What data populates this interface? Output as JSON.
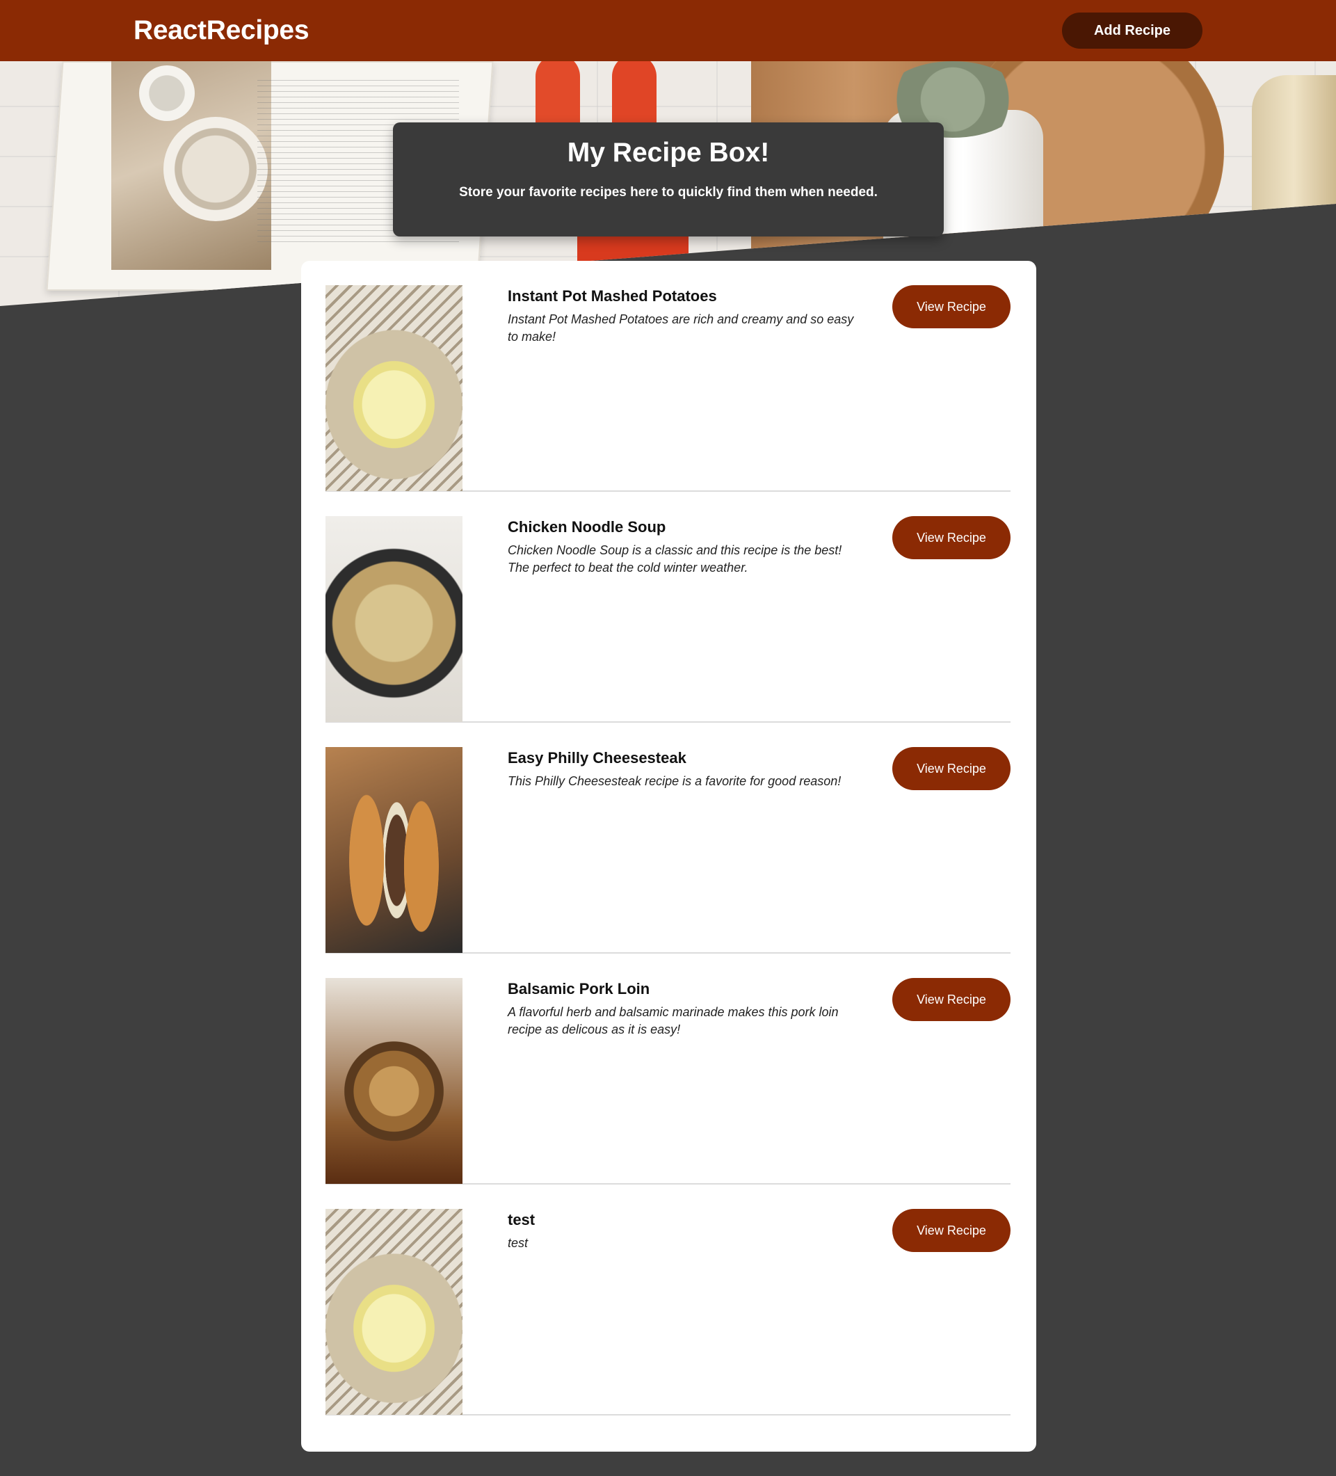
{
  "header": {
    "brand": "ReactRecipes",
    "add_button": "Add Recipe"
  },
  "hero": {
    "title": "My Recipe Box!",
    "subtitle": "Store your favorite recipes here to quickly find them when needed."
  },
  "recipes": [
    {
      "title": "Instant Pot Mashed Potatoes",
      "description": "Instant Pot Mashed Potatoes are rich and creamy and so easy to make!",
      "button": "View Recipe",
      "image_icon": "mashed-potatoes-photo"
    },
    {
      "title": "Chicken Noodle Soup",
      "description": "Chicken Noodle Soup is a classic and this recipe is the best! The perfect to beat the cold winter weather.",
      "button": "View Recipe",
      "image_icon": "chicken-noodle-soup-photo"
    },
    {
      "title": "Easy Philly Cheesesteak",
      "description": "This Philly Cheesesteak recipe is a favorite for good reason!",
      "button": "View Recipe",
      "image_icon": "philly-cheesesteak-photo"
    },
    {
      "title": "Balsamic Pork Loin",
      "description": "A flavorful herb and balsamic marinade makes this pork loin recipe as delicous as it is easy!",
      "button": "View Recipe",
      "image_icon": "pork-loin-photo"
    },
    {
      "title": "test",
      "description": "test",
      "button": "View Recipe",
      "image_icon": "mashed-potatoes-photo"
    }
  ],
  "colors": {
    "brand": "#8b2a04",
    "add_button_bg": "#4a1703",
    "page_bg": "#3f3f3f",
    "hero_card_bg": "#3a3a3a"
  }
}
